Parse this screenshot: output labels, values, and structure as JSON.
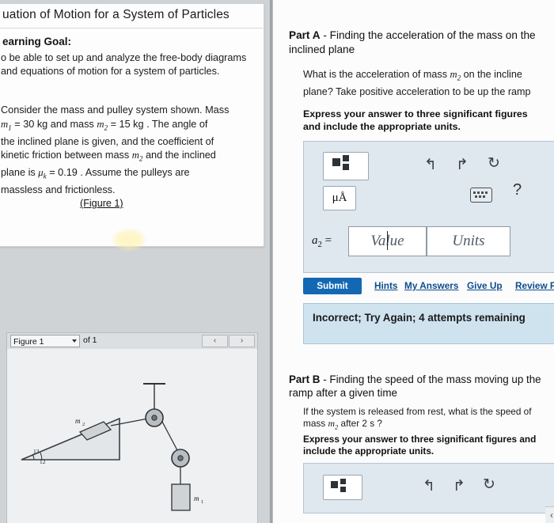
{
  "left": {
    "title": "uation of Motion for a System of Particles",
    "goal_heading": "earning Goal:",
    "goal_body": "o be able to set up and analyze the free-body diagrams and equations of motion for a system of particles.",
    "problem_line1": "Consider the mass and pulley system shown. Mass",
    "problem_line2_pre": "m",
    "problem_line2": "= 30  kg and mass",
    "problem_line2b": "= 15  kg . The angle of",
    "problem_line3": "the inclined plane is given, and the coefficient of",
    "problem_line4": "kinetic friction between mass",
    "problem_line4b": "and the inclined",
    "problem_line5": "plane is",
    "problem_line5b": "= 0.19 . Assume the pulleys are",
    "problem_line6": "massless and frictionless.",
    "figure_link": "(Figure 1)",
    "mass1_symbol": "m1",
    "mass2_symbol": "m2",
    "mu_symbol": "μk"
  },
  "figure_panel": {
    "select_value": "Figure 1",
    "of_label": "of 1",
    "prev_icon": "‹",
    "next_icon": "›",
    "labels": {
      "m1": "m1",
      "m2": "m2",
      "angle1": "13",
      "angle2": "12"
    }
  },
  "partA": {
    "label": "Part A",
    "dash": "-",
    "heading": "Finding the acceleration of the mass on the inclined plane",
    "question": "What is the acceleration of mass m2 on the incline plane? Take positive acceleration to be up the ramp",
    "instruction": "Express your answer to three significant figures and include the appropriate units.",
    "answer_symbol": "a2 =",
    "value_placeholder": "Value",
    "units_placeholder": "Units",
    "toolbar": {
      "template_icon": "template-icon",
      "undo_icon": "↰",
      "redo_icon": "↱",
      "reset_icon": "↻",
      "mu_icon": "μÅ",
      "keyboard_icon": "keyboard-icon",
      "help_icon": "?"
    },
    "submit_label": "Submit",
    "links": [
      "Hints",
      "My Answers",
      "Give Up",
      "Review P"
    ],
    "feedback": "Incorrect; Try Again; 4 attempts remaining"
  },
  "partB": {
    "label": "Part B",
    "dash": "-",
    "heading": "Finding the speed of the mass moving up the ramp after a given time",
    "question": "If the system is released from rest, what is the speed of mass m2 after 2  s ?",
    "instruction": "Express your answer to three significant figures and include the appropriate units.",
    "toolbar": {
      "template_icon": "template-icon",
      "undo_icon": "↰",
      "redo_icon": "↱",
      "reset_icon": "↻"
    }
  },
  "bottom": {
    "scroll_arrow": "‹"
  },
  "colors": {
    "submit_blue": "#1368b3",
    "link_blue": "#0d4d8f",
    "answer_panel": "#dfe7ef",
    "feedback_panel": "#cfe3ef"
  }
}
